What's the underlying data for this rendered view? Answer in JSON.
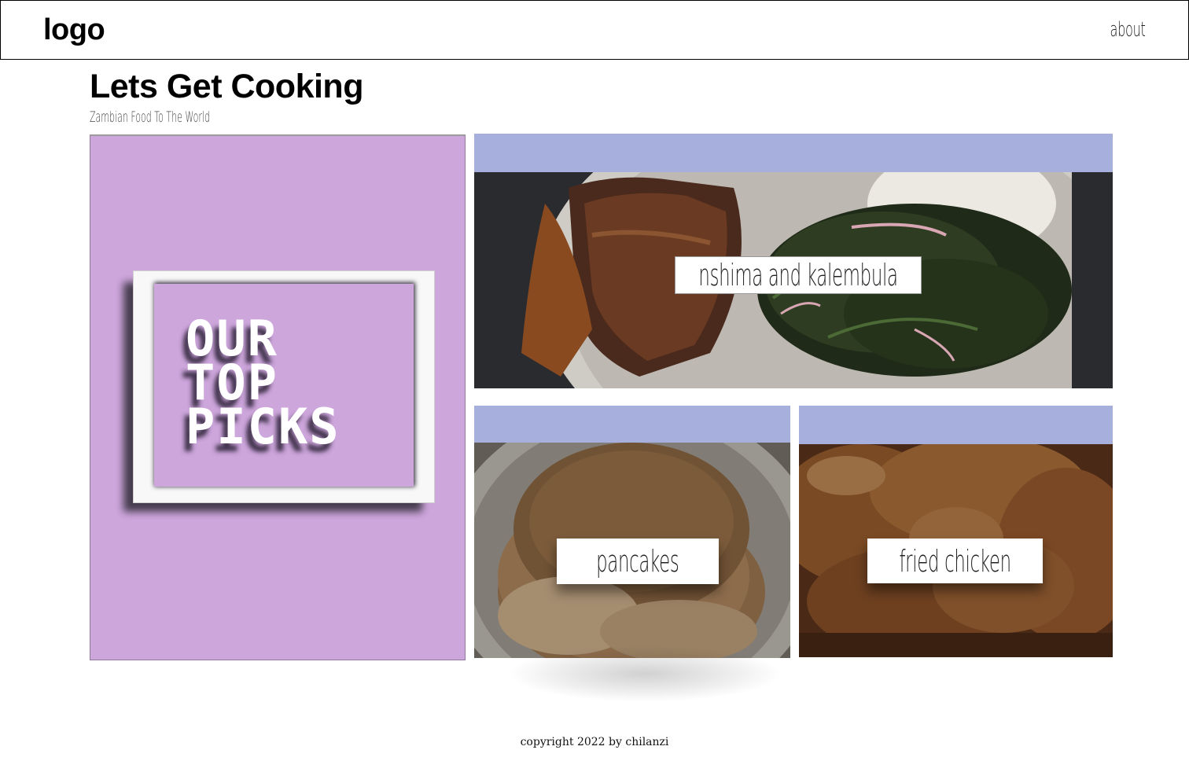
{
  "navbar": {
    "logo": "logo",
    "about_label": "about"
  },
  "header": {
    "title": "Lets Get Cooking",
    "subtitle": "Zambian Food To The World"
  },
  "top_picks": {
    "lines": [
      "OUR",
      "TOP",
      "PICKS"
    ],
    "background_color": "#cda6dc"
  },
  "foods": [
    {
      "label": "nshima and kalembula"
    },
    {
      "label": "pancakes"
    },
    {
      "label": "fried chicken"
    }
  ],
  "colors": {
    "card_band": "#a7b0dc",
    "accent_purple": "#cda6dc"
  },
  "footer": {
    "copyright": "copyright 2022 by chilanzi"
  }
}
